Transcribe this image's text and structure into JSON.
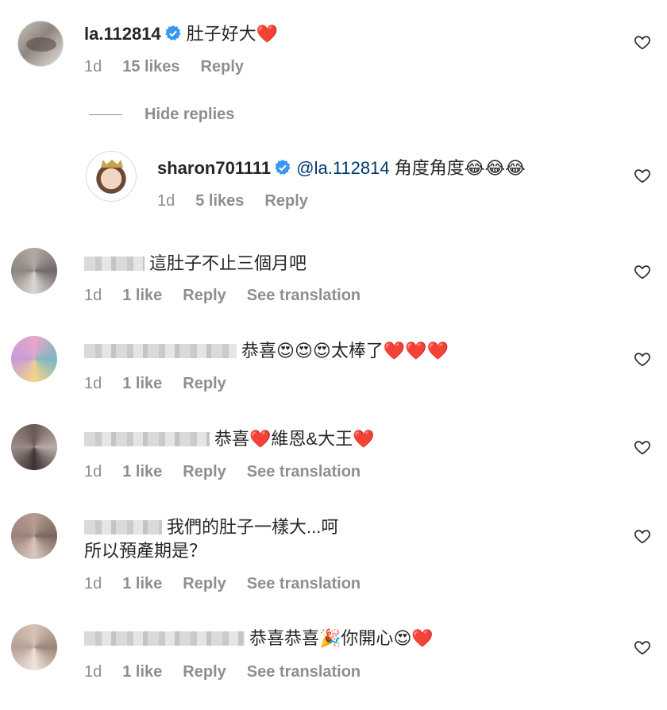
{
  "colors": {
    "text": "#262626",
    "muted": "#8e8e8e",
    "mention": "#00376b",
    "verified": "#3897f0",
    "heart": "#ed4956"
  },
  "comments": [
    {
      "username": "la.112814",
      "verified": true,
      "text": "肚子好大",
      "emoji": "❤️",
      "time": "1d",
      "likes": "15 likes",
      "reply": "Reply"
    },
    {
      "hide_replies": "Hide replies"
    },
    {
      "username": "sharon701111",
      "verified": true,
      "mention": "@la.112814",
      "text": "角度角度",
      "emoji": "😂😂😂",
      "time": "1d",
      "likes": "5 likes",
      "reply": "Reply"
    },
    {
      "text": "這肚子不止三個月吧",
      "time": "1d",
      "likes": "1 like",
      "reply": "Reply",
      "translation": "See translation"
    },
    {
      "text": "恭喜",
      "emoji": "😍😍😍",
      "text2": "太棒了",
      "emoji2": "❤️❤️❤️",
      "time": "1d",
      "likes": "1 like",
      "reply": "Reply"
    },
    {
      "text": "恭喜",
      "emoji": "❤️",
      "text2": "維恩&大王",
      "emoji2": "❤️",
      "time": "1d",
      "likes": "1 like",
      "reply": "Reply",
      "translation": "See translation"
    },
    {
      "text": "我們的肚子一樣大...呵",
      "text_line2": "所以預產期是？",
      "time": "1d",
      "likes": "1 like",
      "reply": "Reply",
      "translation": "See translation"
    },
    {
      "text": "恭喜恭喜",
      "emoji": "🎉",
      "text2": "你開心",
      "emoji2": "😍❤️",
      "time": "1d",
      "likes": "1 like",
      "reply": "Reply",
      "translation": "See translation"
    }
  ]
}
